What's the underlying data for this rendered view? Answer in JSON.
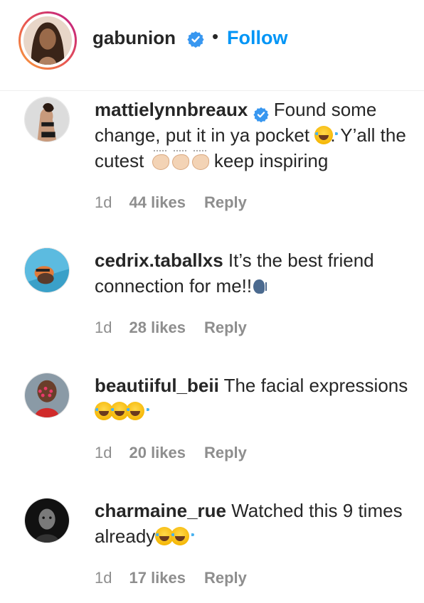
{
  "header": {
    "username": "gabunion",
    "separator": "•",
    "follow_label": "Follow"
  },
  "comments": [
    {
      "username": "mattielynnbreaux",
      "verified": true,
      "text_part1": "Found some change, put it in ya pocket",
      "text_part2": ". Y’all the cutest",
      "text_part3": "keep inspiring",
      "time": "1d",
      "likes": "44 likes",
      "reply": "Reply"
    },
    {
      "username": "cedrix.taballxs",
      "text": "It’s the best friend connection for me!!",
      "time": "1d",
      "likes": "28 likes",
      "reply": "Reply"
    },
    {
      "username": "beautiiful_beii",
      "text": "The facial expressions",
      "time": "1d",
      "likes": "20 likes",
      "reply": "Reply"
    },
    {
      "username": "charmaine_rue",
      "text": "Watched this 9 times already",
      "time": "1d",
      "likes": "17 likes",
      "reply": "Reply"
    }
  ],
  "icons": {
    "verified": "verified-badge-icon",
    "laugh": "face-with-tears-of-joy-icon",
    "clap": "clapping-hands-icon",
    "speak": "speaking-head-icon"
  },
  "colors": {
    "follow": "#0095f6",
    "verified": "#3897f0",
    "meta": "#8e8e8e",
    "text": "#262626"
  }
}
